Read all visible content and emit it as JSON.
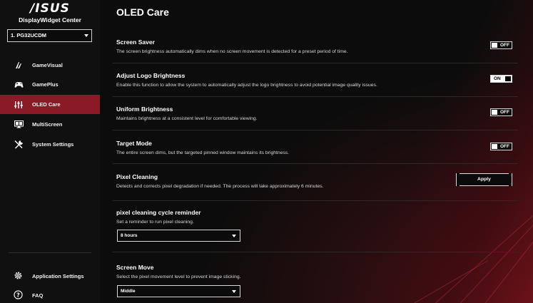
{
  "brand": {
    "logo_text": "/ISUS",
    "app_title": "DisplayWidget Center"
  },
  "monitor_select": {
    "value": "1. PG32UCDM"
  },
  "sidebar": {
    "items": [
      {
        "label": "GameVisual",
        "icon": "gamevisual-icon"
      },
      {
        "label": "GamePlus",
        "icon": "gamepad-icon"
      },
      {
        "label": "OLED Care",
        "icon": "oled-care-icon",
        "active": true
      },
      {
        "label": "MultiScreen",
        "icon": "multiscreen-icon"
      },
      {
        "label": "System Settings",
        "icon": "tools-icon"
      }
    ],
    "footer": [
      {
        "label": "Application Settings",
        "icon": "gear-icon"
      },
      {
        "label": "FAQ",
        "icon": "question-icon"
      }
    ]
  },
  "page": {
    "title": "OLED Care"
  },
  "settings": {
    "screen_saver": {
      "title": "Screen Saver",
      "desc": "The screen brightness automatically dims when no screen movement is detected for a preset period of time.",
      "state": "OFF"
    },
    "logo_brightness": {
      "title": "Adjust Logo Brightness",
      "desc": "Enable this function to allow the system to automatically adjust the logo brightness to avoid potential image quality issues.",
      "state": "ON"
    },
    "uniform_brightness": {
      "title": "Uniform Brightness",
      "desc": "Maintains brightness at a consistent level for comfortable viewing.",
      "state": "OFF"
    },
    "target_mode": {
      "title": "Target Mode",
      "desc": "The entire screen dims, but the targeted pinned window maintains its brightness.",
      "state": "OFF"
    },
    "pixel_cleaning": {
      "title": "Pixel Cleaning",
      "desc": "Detects and corrects pixel degradation if needed. The process will take approximately 6 minutes.",
      "button": "Apply"
    },
    "cleaning_reminder": {
      "title": "pixel cleaning cycle reminder",
      "desc": "Set a reminder to run pixel cleaning.",
      "value": "8 hours"
    },
    "screen_move": {
      "title": "Screen Move",
      "desc": "Select the pixel movement level to prevent image sticking.",
      "value": "Middle"
    }
  },
  "colors": {
    "accent": "#8a1a26",
    "background": "#0c0c0c"
  }
}
